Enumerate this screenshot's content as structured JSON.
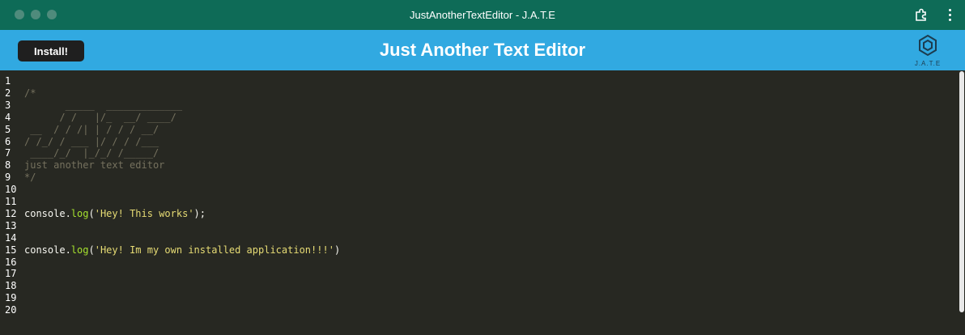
{
  "window": {
    "title": "JustAnotherTextEditor - J.A.T.E"
  },
  "header": {
    "install_label": "Install!",
    "title": "Just Another Text Editor",
    "logo_text": "J.A.T.E"
  },
  "editor": {
    "lines": [
      {
        "n": "1",
        "parts": []
      },
      {
        "n": "2",
        "parts": [
          {
            "t": "/*",
            "c": "cm"
          }
        ]
      },
      {
        "n": "3",
        "parts": [
          {
            "t": "       _____  _____________",
            "c": "cm"
          }
        ]
      },
      {
        "n": "4",
        "parts": [
          {
            "t": "      / /   |/_  __/ ____/",
            "c": "cm"
          }
        ]
      },
      {
        "n": "5",
        "parts": [
          {
            "t": " __  / / /| | / / / __/",
            "c": "cm"
          }
        ]
      },
      {
        "n": "6",
        "parts": [
          {
            "t": "/ /_/ / ___ |/ / / /___",
            "c": "cm"
          }
        ]
      },
      {
        "n": "7",
        "parts": [
          {
            "t": " ____/_/  |_/_/ /_____/",
            "c": "cm"
          }
        ]
      },
      {
        "n": "8",
        "parts": [
          {
            "t": "just another text editor",
            "c": "cm"
          }
        ]
      },
      {
        "n": "9",
        "parts": [
          {
            "t": "*/",
            "c": "cm"
          }
        ]
      },
      {
        "n": "10",
        "parts": []
      },
      {
        "n": "11",
        "parts": []
      },
      {
        "n": "12",
        "parts": [
          {
            "t": "console.",
            "c": "code"
          },
          {
            "t": "log",
            "c": "fn"
          },
          {
            "t": "(",
            "c": "code"
          },
          {
            "t": "'Hey! This works'",
            "c": "str"
          },
          {
            "t": ");",
            "c": "code"
          }
        ]
      },
      {
        "n": "13",
        "parts": []
      },
      {
        "n": "14",
        "parts": []
      },
      {
        "n": "15",
        "parts": [
          {
            "t": "console.",
            "c": "code"
          },
          {
            "t": "log",
            "c": "fn"
          },
          {
            "t": "(",
            "c": "code"
          },
          {
            "t": "'Hey! Im my own installed application!!!'",
            "c": "str"
          },
          {
            "t": ")",
            "c": "code"
          }
        ]
      },
      {
        "n": "16",
        "parts": []
      },
      {
        "n": "17",
        "parts": []
      },
      {
        "n": "18",
        "parts": []
      },
      {
        "n": "19",
        "parts": []
      },
      {
        "n": "20",
        "parts": []
      }
    ]
  },
  "colors": {
    "titlebar": "#0e6b57",
    "header": "#31a9e1",
    "editor_bg": "#272822",
    "comment": "#75715e",
    "function": "#a6e22e",
    "string": "#e6db74"
  }
}
